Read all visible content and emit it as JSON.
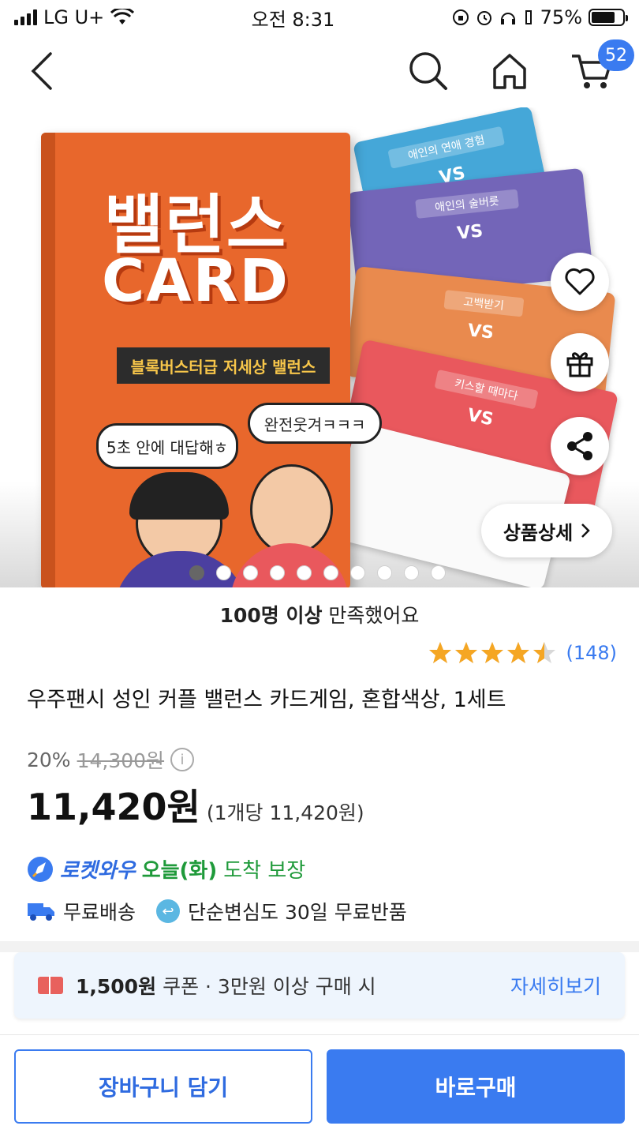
{
  "status_bar": {
    "carrier": "LG U+",
    "time": "오전 8:31",
    "battery": "75%"
  },
  "header": {
    "cart_count": "52"
  },
  "product_image": {
    "box_title_line1": "밸런스",
    "box_title_line2": "CARD",
    "box_tagline": "블록버스터급 저세상 밸런스",
    "bubble_left": "5초 안에 대답해ㅎ",
    "bubble_right": "완전웃겨ㅋㅋㅋ",
    "card_labels": [
      "애인의 연애 경험",
      "애인의 술버릇",
      "고백받기",
      "키스할 때마다"
    ],
    "vs": "VS",
    "detail_button": "상품상세",
    "slide_count": 10,
    "active_slide": 0
  },
  "product": {
    "satisfied_count": "100명 이상",
    "satisfied_suffix": "만족했어요",
    "rating": 4.5,
    "review_count": "(148)",
    "title": "우주팬시 성인 커플 밸런스 카드게임, 혼합색상, 1세트",
    "discount": "20%",
    "original_price": "14,300원",
    "price": "11,420원",
    "unit_price": "(1개당 11,420원)",
    "rocket_brand": "로켓와우",
    "arrival_day": "오늘(화)",
    "arrival_text": "도착 보장",
    "free_shipping": "무료배송",
    "free_return": "단순변심도 30일 무료반품"
  },
  "coupon": {
    "amount": "1,500원",
    "text": "쿠폰  ·  3만원 이상 구매 시",
    "more": "자세히보기"
  },
  "actions": {
    "cart_button": "장바구니 담기",
    "buy_button": "바로구매"
  },
  "colors": {
    "accent": "#3a7bf0",
    "rocket_green": "#1f9a3a",
    "star": "#f5a623"
  }
}
